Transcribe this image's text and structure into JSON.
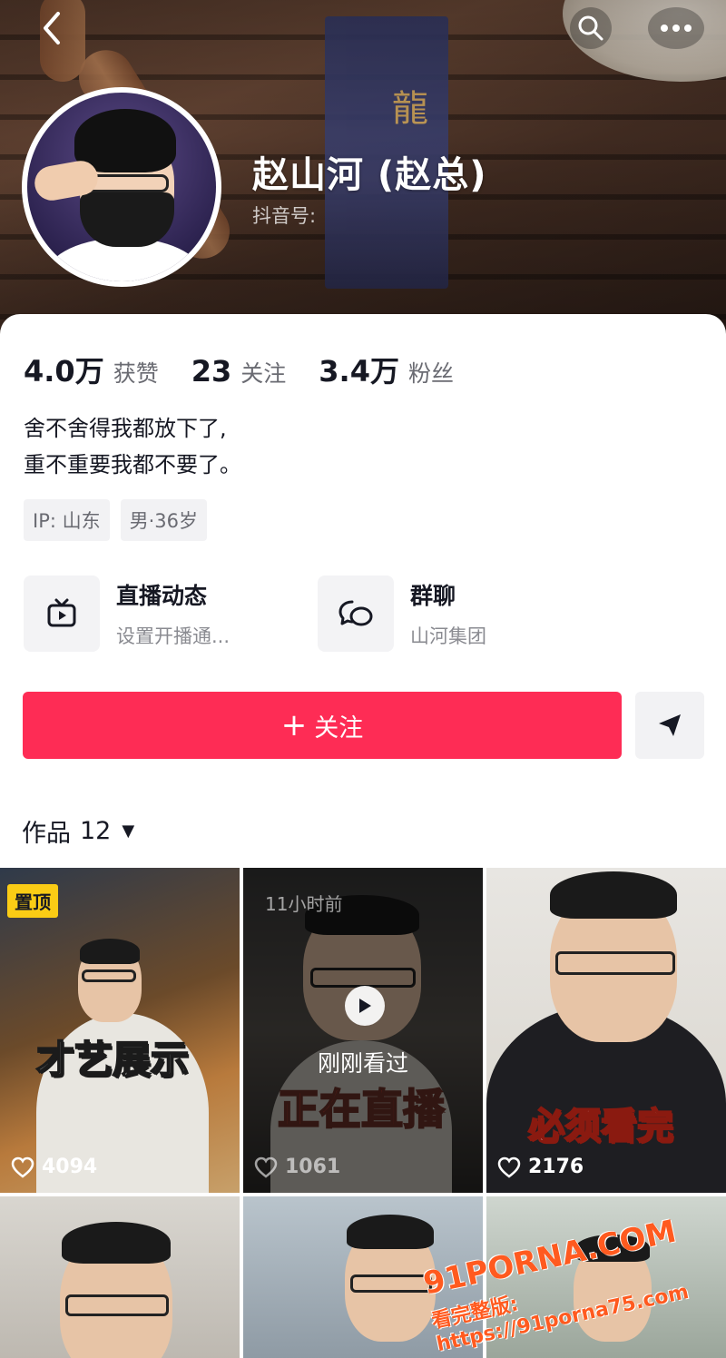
{
  "profile": {
    "name": "赵山河 (赵总)",
    "id_label": "抖音号:"
  },
  "stats": [
    {
      "value": "4.0万",
      "label": "获赞"
    },
    {
      "value": "23",
      "label": "关注"
    },
    {
      "value": "3.4万",
      "label": "粉丝"
    }
  ],
  "bio": {
    "line1": "舍不舍得我都放下了,",
    "line2": "重不重要我都不要了。"
  },
  "tags": [
    "IP: 山东",
    "男·36岁"
  ],
  "features": {
    "live": {
      "title": "直播动态",
      "subtitle": "设置开播通..."
    },
    "group": {
      "title": "群聊",
      "subtitle": "山河集团"
    }
  },
  "actions": {
    "follow_label": "关注",
    "follow_plus": "+"
  },
  "works": {
    "label": "作品",
    "count": "12"
  },
  "videos": [
    {
      "pinned_label": "置顶",
      "caption": "才艺展示",
      "likes": "4094"
    },
    {
      "time_label": "11小时前",
      "seen_label": "刚刚看过",
      "caption": "正在直播",
      "likes": "1061"
    },
    {
      "caption": "必须看完",
      "likes": "2176"
    }
  ],
  "watermark": {
    "line1": "91PORNA.COM",
    "line2": "看完整版: https://91porna75.com"
  },
  "colors": {
    "accent": "#fe2c55",
    "pin_badge": "#facc15"
  }
}
